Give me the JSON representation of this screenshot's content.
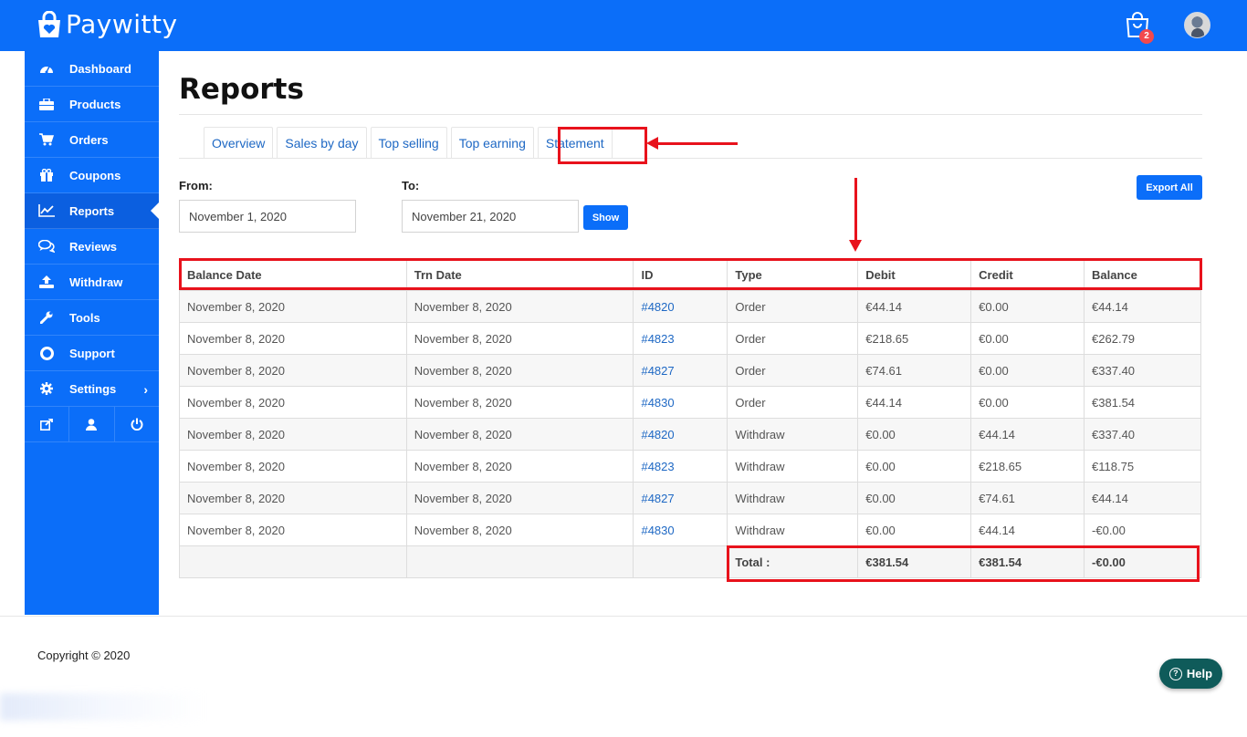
{
  "app": {
    "brand": "Paywitty",
    "cart_count": "2"
  },
  "sidebar": {
    "items": [
      {
        "label": "Dashboard",
        "icon": "dashboard-icon"
      },
      {
        "label": "Products",
        "icon": "briefcase-icon"
      },
      {
        "label": "Orders",
        "icon": "cart-icon"
      },
      {
        "label": "Coupons",
        "icon": "gift-icon"
      },
      {
        "label": "Reports",
        "icon": "chart-line-icon"
      },
      {
        "label": "Reviews",
        "icon": "comments-icon"
      },
      {
        "label": "Withdraw",
        "icon": "upload-icon"
      },
      {
        "label": "Tools",
        "icon": "wrench-icon"
      },
      {
        "label": "Support",
        "icon": "lifebuoy-icon"
      },
      {
        "label": "Settings",
        "icon": "gear-icon"
      }
    ],
    "bottom_icons": [
      "external-link-icon",
      "user-icon",
      "power-icon"
    ]
  },
  "page": {
    "title": "Reports"
  },
  "tabs": [
    "Overview",
    "Sales by day",
    "Top selling",
    "Top earning",
    "Statement"
  ],
  "filters": {
    "from_label": "From:",
    "from_value": "November 1, 2020",
    "to_label": "To:",
    "to_value": "November 21, 2020",
    "show_label": "Show",
    "export_label": "Export All"
  },
  "table": {
    "columns": [
      "Balance Date",
      "Trn Date",
      "ID",
      "Type",
      "Debit",
      "Credit",
      "Balance"
    ],
    "rows": [
      [
        "November 8, 2020",
        "November 8, 2020",
        "#4820",
        "Order",
        "€44.14",
        "€0.00",
        "€44.14"
      ],
      [
        "November 8, 2020",
        "November 8, 2020",
        "#4823",
        "Order",
        "€218.65",
        "€0.00",
        "€262.79"
      ],
      [
        "November 8, 2020",
        "November 8, 2020",
        "#4827",
        "Order",
        "€74.61",
        "€0.00",
        "€337.40"
      ],
      [
        "November 8, 2020",
        "November 8, 2020",
        "#4830",
        "Order",
        "€44.14",
        "€0.00",
        "€381.54"
      ],
      [
        "November 8, 2020",
        "November 8, 2020",
        "#4820",
        "Withdraw",
        "€0.00",
        "€44.14",
        "€337.40"
      ],
      [
        "November 8, 2020",
        "November 8, 2020",
        "#4823",
        "Withdraw",
        "€0.00",
        "€218.65",
        "€118.75"
      ],
      [
        "November 8, 2020",
        "November 8, 2020",
        "#4827",
        "Withdraw",
        "€0.00",
        "€74.61",
        "€44.14"
      ],
      [
        "November 8, 2020",
        "November 8, 2020",
        "#4830",
        "Withdraw",
        "€0.00",
        "€44.14",
        "-€0.00"
      ]
    ],
    "total": {
      "label": "Total :",
      "debit": "€381.54",
      "credit": "€381.54",
      "balance": "-€0.00"
    }
  },
  "footer": {
    "copyright": "Copyright © 2020",
    "help_label": "Help"
  },
  "colors": {
    "primary": "#0b6ef9",
    "annotation": "#e8121c",
    "help": "#0f5b5a"
  }
}
